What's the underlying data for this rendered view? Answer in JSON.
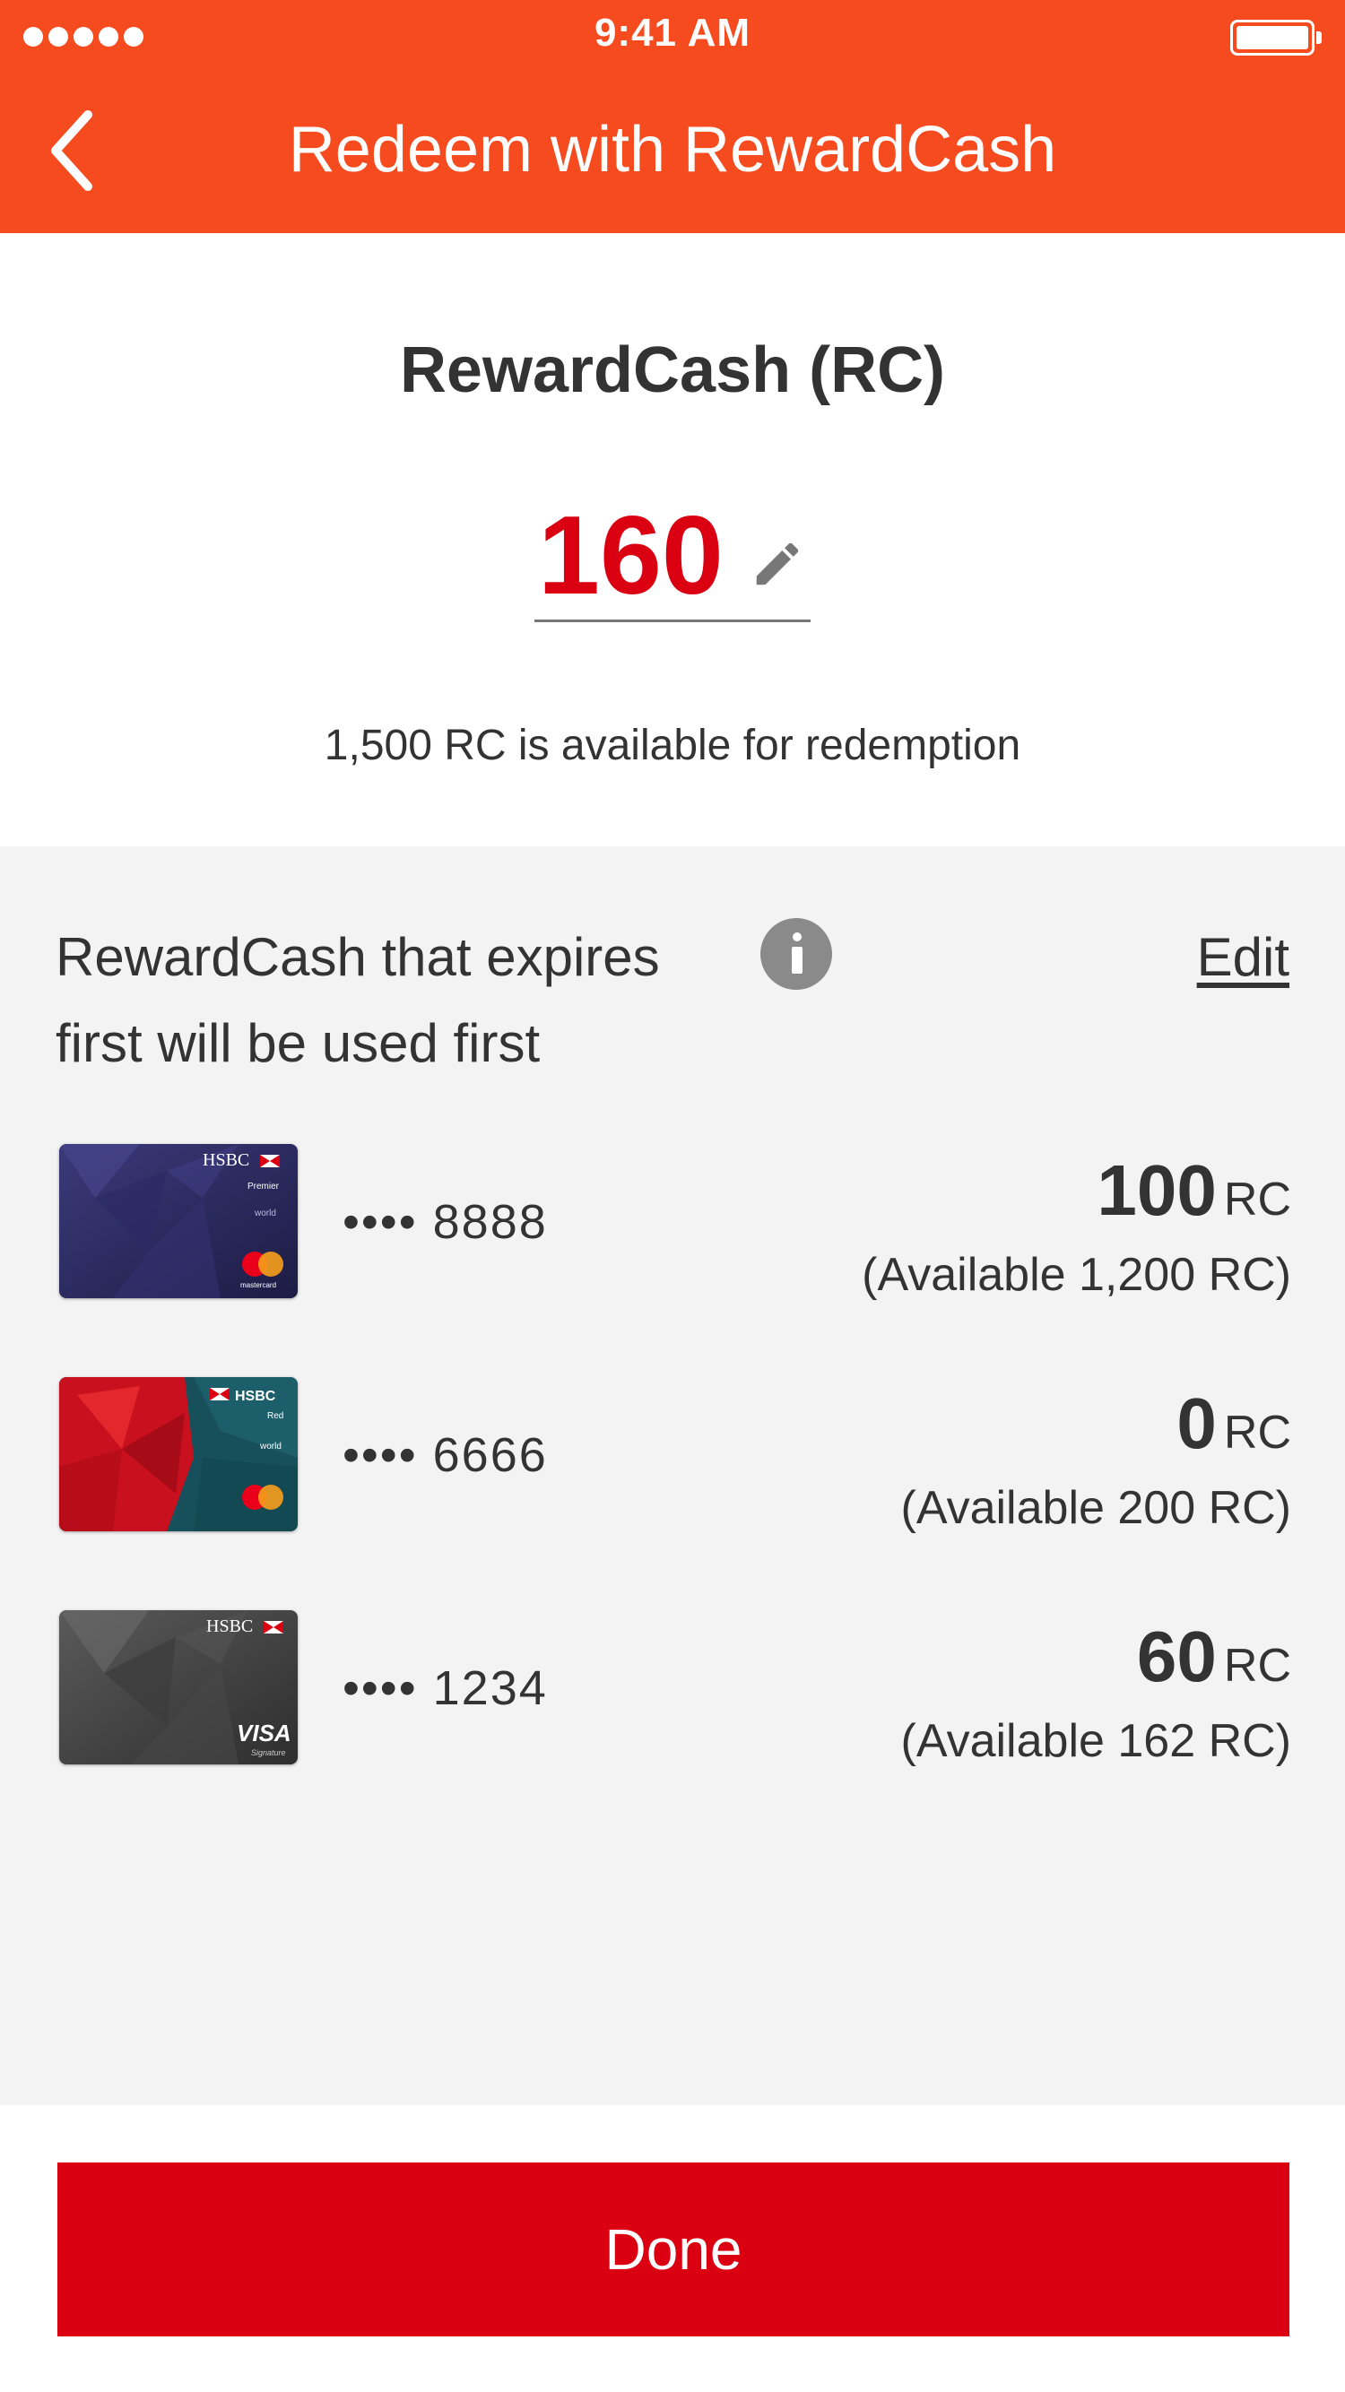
{
  "status_bar": {
    "time": "9:41 AM"
  },
  "nav": {
    "title": "Redeem with RewardCash",
    "back_icon": "chevron-left-icon"
  },
  "summary": {
    "heading": "RewardCash (RC)",
    "amount": "160",
    "edit_icon": "pencil-icon",
    "available_text": "1,500 RC is available for redemption"
  },
  "panel": {
    "expiry_line1": "RewardCash that expires",
    "expiry_line2": "first will be used first",
    "info_icon": "info-icon",
    "edit_label": "Edit"
  },
  "cards": [
    {
      "name": "HSBC Premier World Mastercard",
      "brand_text": "HSBC",
      "tier": "Premier",
      "network": "mastercard",
      "masked_number": "•••• 8888",
      "amount": "100",
      "unit": "RC",
      "available": "(Available 1,200 RC)"
    },
    {
      "name": "HSBC Red World Mastercard",
      "brand_text": "HSBC",
      "tier": "Red",
      "network": "mastercard",
      "masked_number": "•••• 6666",
      "amount": "0",
      "unit": "RC",
      "available": "(Available 200 RC)"
    },
    {
      "name": "HSBC Visa Signature",
      "brand_text": "HSBC",
      "tier": "Signature",
      "network": "VISA",
      "masked_number": "•••• 1234",
      "amount": "60",
      "unit": "RC",
      "available": "(Available 162 RC)"
    }
  ],
  "footer": {
    "done_label": "Done"
  },
  "colors": {
    "header_bg": "#f54b1f",
    "accent_red": "#db0011",
    "panel_bg": "#f3f3f3",
    "text": "#333333"
  }
}
